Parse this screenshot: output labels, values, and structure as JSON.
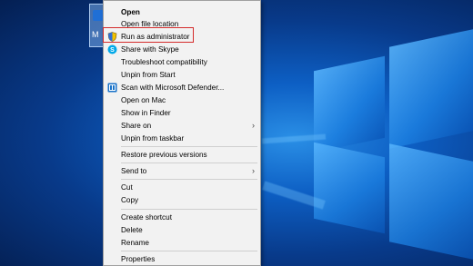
{
  "desktop": {
    "icon_label": "M"
  },
  "menu": {
    "items": [
      {
        "label": "Open",
        "bold": true
      },
      {
        "label": "Open file location"
      },
      {
        "label": "Run as administrator",
        "icon": "shield-icon"
      },
      {
        "label": "Share with Skype",
        "icon": "skype-icon"
      },
      {
        "label": "Troubleshoot compatibility"
      },
      {
        "label": "Unpin from Start"
      },
      {
        "label": "Scan with Microsoft Defender...",
        "icon": "defender-icon"
      },
      {
        "label": "Open on Mac"
      },
      {
        "label": "Show in Finder"
      },
      {
        "label": "Share on",
        "submenu": true
      },
      {
        "label": "Unpin from taskbar"
      },
      {
        "label": "Restore previous versions"
      },
      {
        "label": "Send to",
        "submenu": true
      },
      {
        "label": "Cut"
      },
      {
        "label": "Copy"
      },
      {
        "label": "Create shortcut"
      },
      {
        "label": "Delete"
      },
      {
        "label": "Rename"
      },
      {
        "label": "Properties"
      }
    ],
    "submenu_arrow": "›"
  },
  "colors": {
    "highlight_border": "#d42b2b",
    "menu_bg": "#f2f2f2"
  }
}
